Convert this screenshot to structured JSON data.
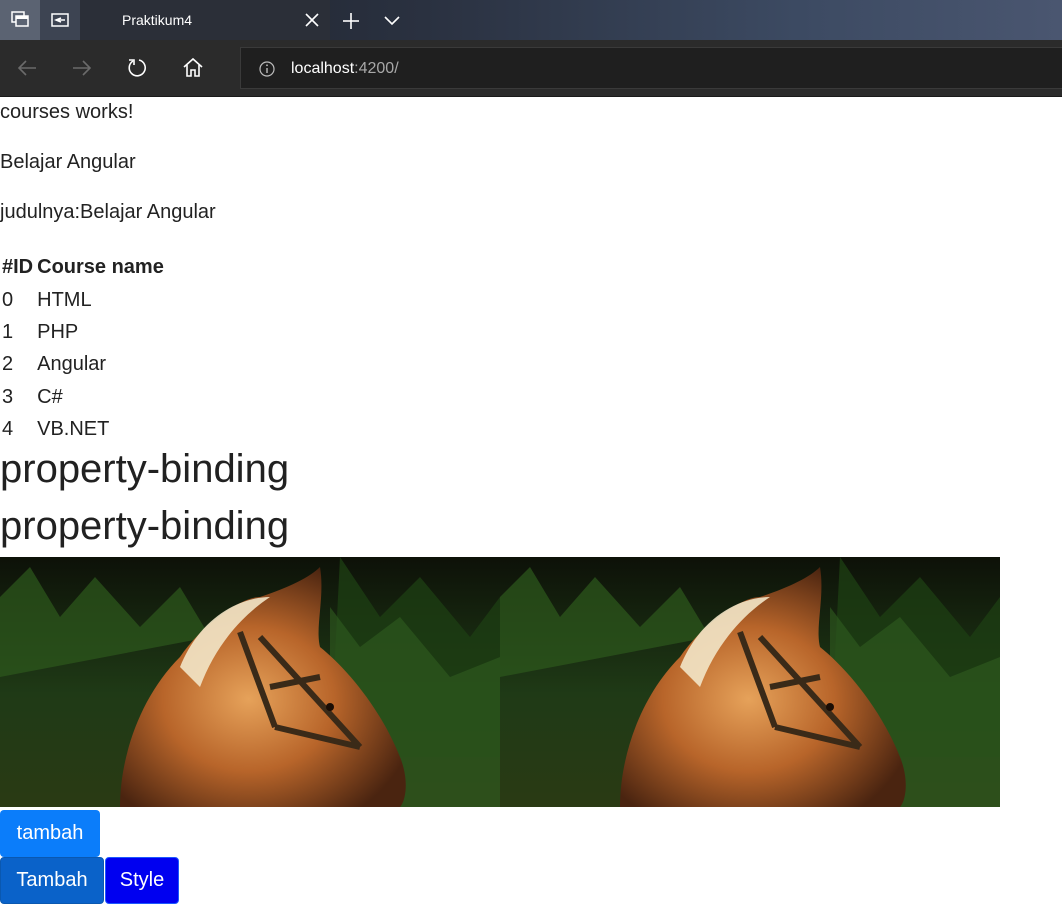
{
  "browser": {
    "tab_title": "Praktikum4",
    "address_host": "localhost",
    "address_port": ":4200/"
  },
  "page": {
    "line1": "courses works!",
    "line2": "Belajar Angular",
    "line3": "judulnya:Belajar Angular",
    "table": {
      "headers": [
        "#ID",
        "Course name"
      ],
      "rows": [
        {
          "id": "0",
          "name": "HTML"
        },
        {
          "id": "1",
          "name": "PHP"
        },
        {
          "id": "2",
          "name": "Angular"
        },
        {
          "id": "3",
          "name": "C#"
        },
        {
          "id": "4",
          "name": "VB.NET"
        }
      ]
    },
    "heading1": "property-binding",
    "heading2": "property-binding",
    "buttons": {
      "tambah_lower": "tambah",
      "tambah": "Tambah",
      "style": "Style"
    }
  },
  "colors": {
    "primary_button": "#0b7dfa",
    "dark_button": "#0a62c9",
    "style_button": "#0000f0"
  },
  "icons": [
    "tab-actions-icon",
    "set-aside-icon",
    "close-icon",
    "plus-icon",
    "chevron-down-icon",
    "back-icon",
    "forward-icon",
    "refresh-icon",
    "home-icon",
    "info-icon"
  ]
}
